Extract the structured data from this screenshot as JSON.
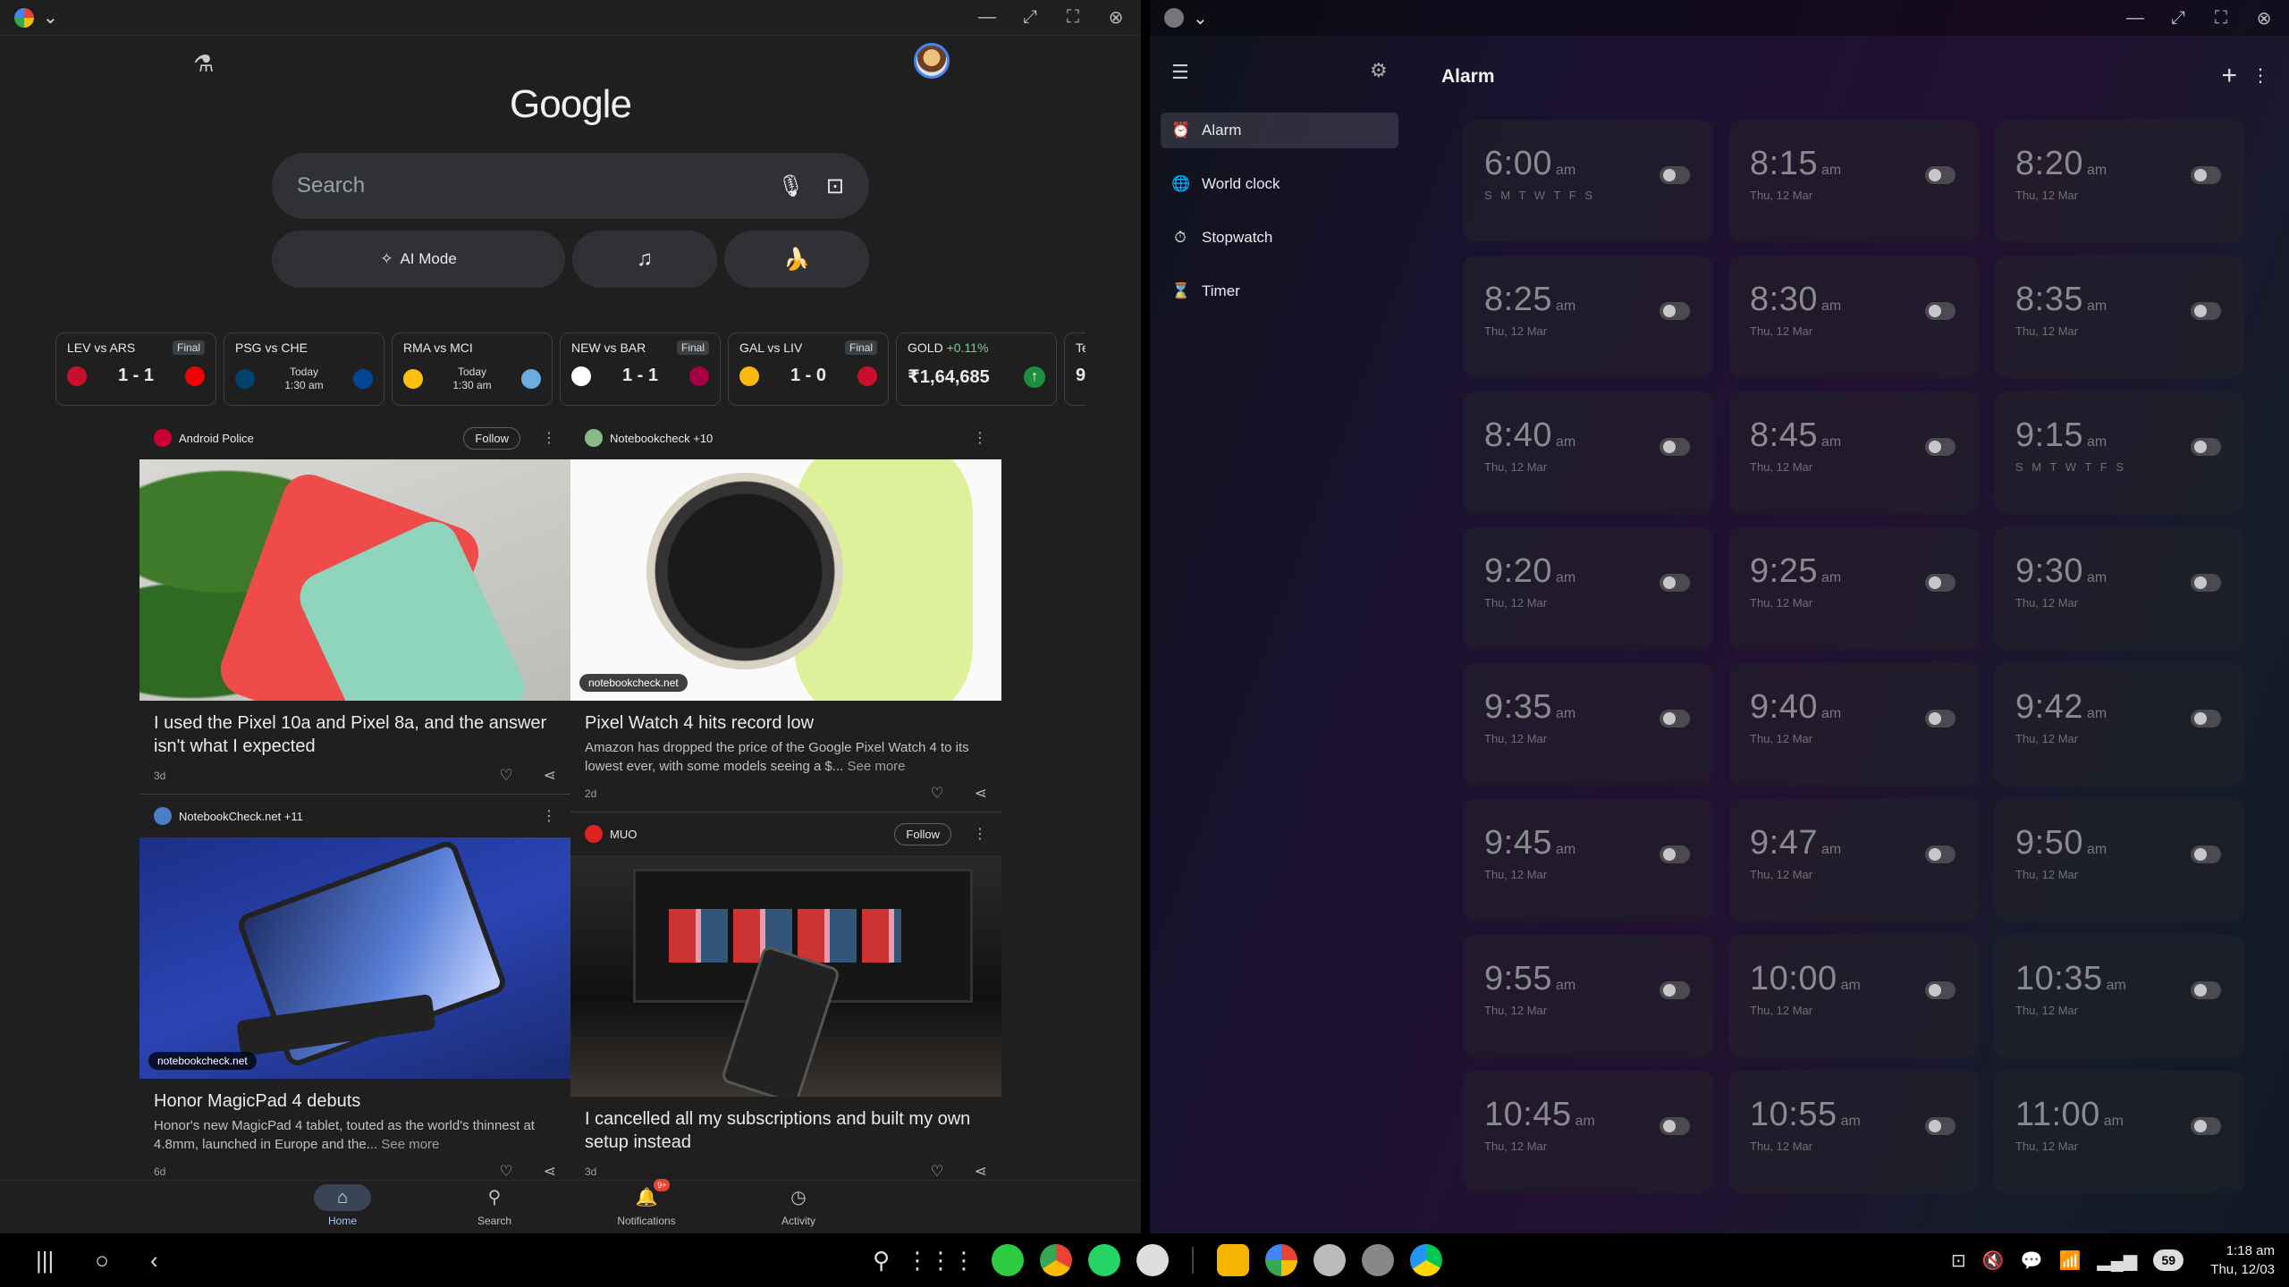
{
  "google": {
    "logo": "Google",
    "search_placeholder": "Search",
    "ai_mode": "AI Mode",
    "scores": [
      {
        "teams": "LEV vs ARS",
        "status": "Final",
        "result": "1 - 1",
        "home_color": "#c8102e",
        "away_color": "#ef0107"
      },
      {
        "teams": "PSG vs CHE",
        "status": "",
        "when1": "Today",
        "when2": "1:30 am",
        "home_color": "#004170",
        "away_color": "#034694"
      },
      {
        "teams": "RMA vs MCI",
        "status": "",
        "when1": "Today",
        "when2": "1:30 am",
        "home_color": "#febe10",
        "away_color": "#6cabdd"
      },
      {
        "teams": "NEW vs BAR",
        "status": "Final",
        "result": "1 - 1",
        "home_color": "#ffffff",
        "away_color": "#a50044"
      },
      {
        "teams": "GAL vs LIV",
        "status": "Final",
        "result": "1 - 0",
        "home_color": "#fdb912",
        "away_color": "#c8102e"
      }
    ],
    "gold": {
      "label": "GOLD",
      "change": "+0.11%",
      "value": "₹1,64,685"
    },
    "partial_card": {
      "label": "Te",
      "value": "9"
    },
    "articles": [
      {
        "source": "Android Police",
        "follow": "Follow",
        "title": "I used the Pixel 10a and Pixel 8a, and the answer isn't what I expected",
        "age": "3d"
      },
      {
        "source": "NotebookCheck.net +11",
        "title": "Honor MagicPad 4 debuts",
        "desc": "Honor's new MagicPad 4 tablet, touted as the world's thinnest at 4.8mm, launched in Europe and the...",
        "see_more": "See more",
        "tag": "notebookcheck.net",
        "age": "6d"
      },
      {
        "source": "Notebookcheck +10",
        "title": "Pixel Watch 4 hits record low",
        "desc": "Amazon has dropped the price of the Google Pixel Watch 4 to its lowest ever, with some models seeing a $...",
        "see_more": "See more",
        "tag": "notebookcheck.net",
        "age": "2d"
      },
      {
        "source": "MUO",
        "follow": "Follow",
        "title": "I cancelled all my subscriptions and built my own setup instead",
        "age": "3d"
      }
    ],
    "nav": {
      "home": "Home",
      "search": "Search",
      "notifications": "Notifications",
      "notif_count": "9+",
      "activity": "Activity"
    }
  },
  "clock": {
    "title": "Alarm",
    "sidebar": [
      "Alarm",
      "World clock",
      "Stopwatch",
      "Timer"
    ],
    "alarms": [
      {
        "time": "6:00",
        "ampm": "am",
        "sub": "S M T W T F S",
        "days": true
      },
      {
        "time": "8:15",
        "ampm": "am",
        "sub": "Thu, 12 Mar"
      },
      {
        "time": "8:20",
        "ampm": "am",
        "sub": "Thu, 12 Mar"
      },
      {
        "time": "8:25",
        "ampm": "am",
        "sub": "Thu, 12 Mar"
      },
      {
        "time": "8:30",
        "ampm": "am",
        "sub": "Thu, 12 Mar"
      },
      {
        "time": "8:35",
        "ampm": "am",
        "sub": "Thu, 12 Mar"
      },
      {
        "time": "8:40",
        "ampm": "am",
        "sub": "Thu, 12 Mar"
      },
      {
        "time": "8:45",
        "ampm": "am",
        "sub": "Thu, 12 Mar"
      },
      {
        "time": "9:15",
        "ampm": "am",
        "sub": "S M T W T F S",
        "days": true
      },
      {
        "time": "9:20",
        "ampm": "am",
        "sub": "Thu, 12 Mar"
      },
      {
        "time": "9:25",
        "ampm": "am",
        "sub": "Thu, 12 Mar"
      },
      {
        "time": "9:30",
        "ampm": "am",
        "sub": "Thu, 12 Mar"
      },
      {
        "time": "9:35",
        "ampm": "am",
        "sub": "Thu, 12 Mar"
      },
      {
        "time": "9:40",
        "ampm": "am",
        "sub": "Thu, 12 Mar"
      },
      {
        "time": "9:42",
        "ampm": "am",
        "sub": "Thu, 12 Mar"
      },
      {
        "time": "9:45",
        "ampm": "am",
        "sub": "Thu, 12 Mar"
      },
      {
        "time": "9:47",
        "ampm": "am",
        "sub": "Thu, 12 Mar"
      },
      {
        "time": "9:50",
        "ampm": "am",
        "sub": "Thu, 12 Mar"
      },
      {
        "time": "9:55",
        "ampm": "am",
        "sub": "Thu, 12 Mar"
      },
      {
        "time": "10:00",
        "ampm": "am",
        "sub": "Thu, 12 Mar"
      },
      {
        "time": "10:35",
        "ampm": "am",
        "sub": "Thu, 12 Mar"
      },
      {
        "time": "10:45",
        "ampm": "am",
        "sub": "Thu, 12 Mar"
      },
      {
        "time": "10:55",
        "ampm": "am",
        "sub": "Thu, 12 Mar"
      },
      {
        "time": "11:00",
        "ampm": "am",
        "sub": "Thu, 12 Mar"
      }
    ]
  },
  "taskbar": {
    "battery": "59",
    "time": "1:18 am",
    "date": "Thu, 12/03"
  }
}
